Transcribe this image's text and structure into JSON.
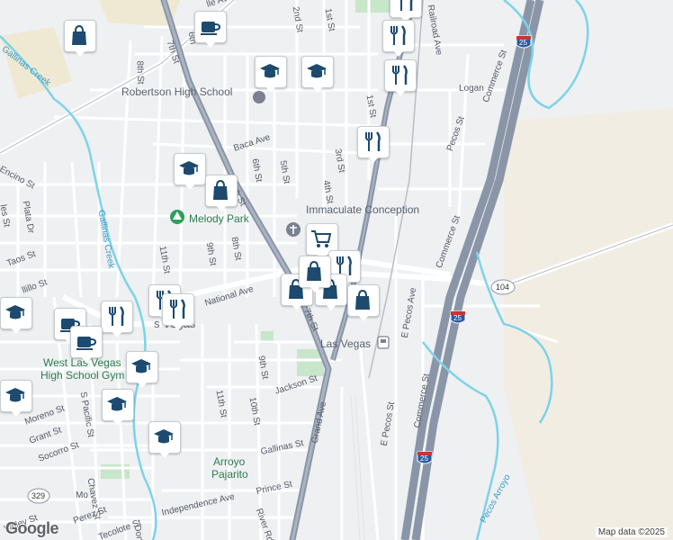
{
  "map": {
    "attribution": "Map data ©2025",
    "logo": "Google"
  },
  "labels": {
    "robertson": "Robertson High School",
    "immaculate": "Immaculate Conception",
    "melody_park": "Melody Park",
    "las_vegas_station": "Las Vegas",
    "las_vegas_town": "Las Vegas",
    "west_las_vegas_hs_1": "West Las Vegas",
    "west_las_vegas_hs_2": "High School Gym",
    "arroyo_pajarito_1": "Arroyo",
    "arroyo_pajarito_2": "Pajarito",
    "gallinas_creek_1": "Gallinas Creek",
    "gallinas_creek_2": "Gallinas Creek",
    "pecos_arroyo": "Pecos Arroyo",
    "logan": "Logan",
    "baca_ave": "Baca Ave",
    "national_ave": "National Ave",
    "jackson_st": "Jackson St",
    "gallinas_st": "Gallinas St",
    "prince_st": "Prince St",
    "independence_ave": "Independence Ave",
    "river_rd": "River Rd",
    "grand_ave": "Grand Ave",
    "seventh_st_top": "7th St",
    "seventh_st_mid": "7th St",
    "eighth_st_top": "8th St",
    "eighth_st_mid": "8th St",
    "sixth_st": "6th St",
    "fifth_st": "5th St",
    "fourth_st": "4th St",
    "third_st": "3rd St",
    "second_st": "2nd St",
    "first_st_top": "1st St",
    "first_st_mid": "1st St",
    "ninth_st_mid": "9th St",
    "ninth_st_low": "9th St",
    "tenth_st": "10th St",
    "eleventh_st_mid": "11th St",
    "eleventh_st_low": "11th St",
    "fourth_st_low": "4th St",
    "railroad_ave": "Railroad Ave",
    "commerce_st_1": "Commerce St",
    "commerce_st_2": "Commerce St",
    "commerce_st_3": "Commerce St",
    "pecos_st": "Pecos St",
    "e_pecos_ave": "E Pecos Ave",
    "e_pecos_st": "E Pecos St",
    "encino_st": "Encino St",
    "plata_dr": "Plata Dr",
    "taos_st": "Taos St",
    "moreno_st": "Moreno St",
    "grant_st": "Grant St",
    "socorro_st": "Socorro St",
    "s_pacific_st": "S Pacific St",
    "chavez_st": "Chavez St",
    "perez_st": "Perez St",
    "tecolote_st": "Tecolote St",
    "valley_st": "Valley St",
    "dona_st": "Don",
    "las_vegas_town_prefix": "s Vegas",
    "illo_st": "llillo St",
    "mo_st": "Mo",
    "les_st": "les St",
    "sixth_st_top": "6th",
    "ville_ave": "lle Ave",
    "route_104": "104",
    "i25_top": "25",
    "i25_mid": "25",
    "i25_bottom": "25",
    "route_329": "329"
  },
  "markers": [
    {
      "icon": "shopping-bag-icon"
    },
    {
      "icon": "coffee-cup-icon"
    },
    {
      "icon": "restaurant-icon"
    },
    {
      "icon": "restaurant-icon"
    },
    {
      "icon": "restaurant-icon"
    },
    {
      "icon": "school-icon"
    },
    {
      "icon": "school-icon"
    },
    {
      "icon": "restaurant-icon"
    },
    {
      "icon": "school-icon"
    },
    {
      "icon": "shopping-bag-icon"
    },
    {
      "icon": "shopping-cart-icon"
    },
    {
      "icon": "restaurant-icon"
    },
    {
      "icon": "shopping-bag-icon"
    },
    {
      "icon": "shopping-bag-icon"
    },
    {
      "icon": "shopping-bag-icon"
    },
    {
      "icon": "shopping-bag-icon"
    },
    {
      "icon": "restaurant-icon"
    },
    {
      "icon": "restaurant-icon"
    },
    {
      "icon": "school-icon"
    },
    {
      "icon": "restaurant-icon"
    },
    {
      "icon": "coffee-cup-icon"
    },
    {
      "icon": "coffee-cup-icon"
    },
    {
      "icon": "school-icon"
    },
    {
      "icon": "school-icon"
    },
    {
      "icon": "school-icon"
    },
    {
      "icon": "school-icon"
    }
  ],
  "colors": {
    "road": "#ffffff",
    "highway": "#8a96a8",
    "water": "#7dd3e8",
    "park": "#c8e6c9",
    "desert": "#f1ede3",
    "sand": "#efe6c6",
    "marker_icon": "#1d4a6e"
  }
}
